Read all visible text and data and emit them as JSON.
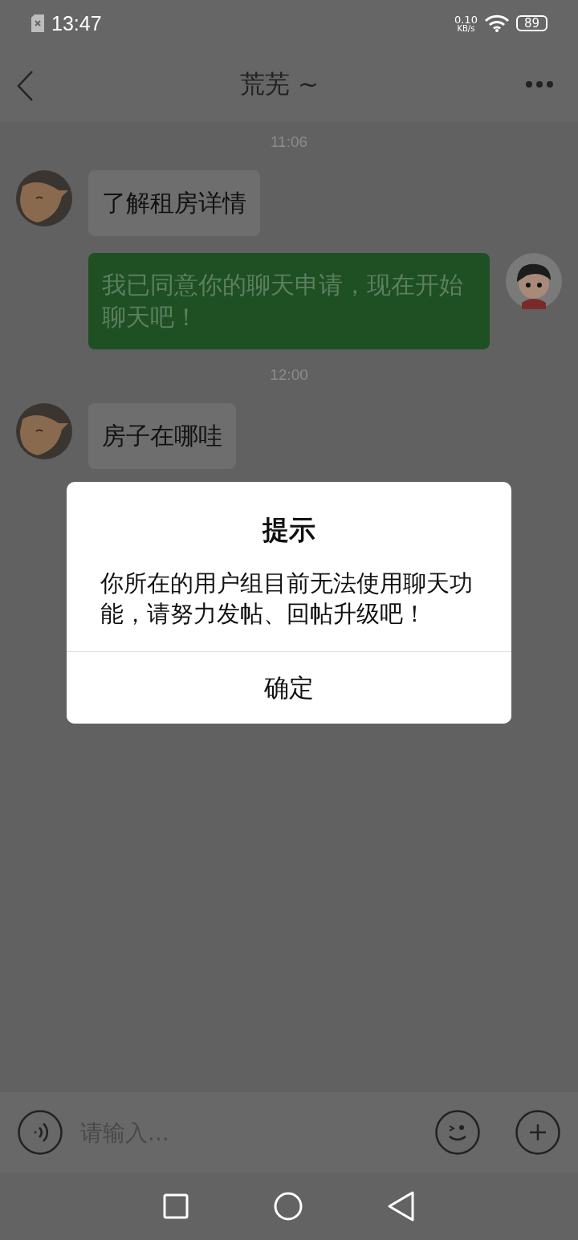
{
  "status_bar": {
    "time": "13:47",
    "net_speed": "0.10",
    "net_unit": "KB/s",
    "battery": "89"
  },
  "header": {
    "title": "荒芜 ~"
  },
  "messages": [
    {
      "kind": "time",
      "text": "11:06"
    },
    {
      "kind": "incoming",
      "text": "了解租房详情"
    },
    {
      "kind": "outgoing",
      "text": "我已同意你的聊天申请，现在开始聊天吧！"
    },
    {
      "kind": "time",
      "text": "12:00"
    },
    {
      "kind": "incoming",
      "text": "房子在哪哇"
    }
  ],
  "input": {
    "placeholder": "请输入..."
  },
  "dialog": {
    "title": "提示",
    "message": "你所在的用户组目前无法使用聊天功能，请努力发帖、回帖升级吧！",
    "button": "确定"
  }
}
